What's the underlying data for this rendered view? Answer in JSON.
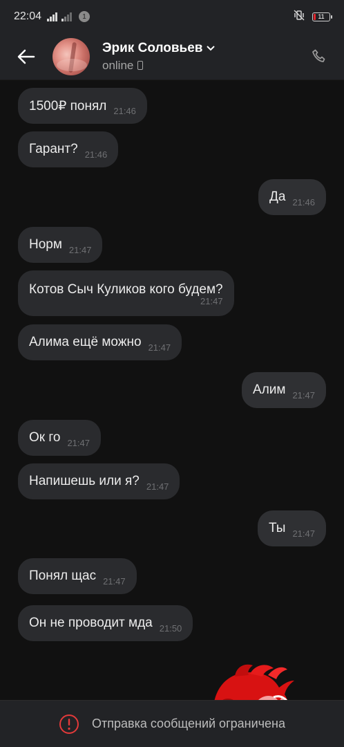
{
  "status_bar": {
    "time": "22:04",
    "notification_count": "1",
    "battery_level": "11",
    "battery_percent": 11,
    "battery_color": "#e0242b"
  },
  "header": {
    "back_icon": "arrow-left-icon",
    "contact_name": "Эрик Соловьев",
    "presence": "online",
    "device_icon": "phone-icon",
    "call_icon": "call-icon"
  },
  "messages": [
    {
      "dir": "in",
      "text": "1500₽ понял",
      "time": "21:46"
    },
    {
      "dir": "in",
      "text": "Гарант?",
      "time": "21:46"
    },
    {
      "dir": "out",
      "text": "Да",
      "time": "21:46"
    },
    {
      "dir": "in",
      "text": "Норм",
      "time": "21:47"
    },
    {
      "dir": "in",
      "text": "Котов Сыч Куликов кого будем?",
      "time": "21:47"
    },
    {
      "dir": "in",
      "text": "Алима ещё можно",
      "time": "21:47"
    },
    {
      "dir": "out",
      "text": "Алим",
      "time": "21:47"
    },
    {
      "dir": "in",
      "text": "Ок го",
      "time": "21:47"
    },
    {
      "dir": "in",
      "text": "Напишешь или я?",
      "time": "21:47"
    },
    {
      "dir": "out",
      "text": "Ты",
      "time": "21:47"
    },
    {
      "dir": "in",
      "text": "Понял щас",
      "time": "21:47"
    },
    {
      "dir": "in",
      "text": "Он не проводит мда",
      "time": "21:50"
    }
  ],
  "footer": {
    "warning_icon": "warning-icon",
    "text": "Отправка сообщений ограничена"
  },
  "colors": {
    "background": "#111111",
    "bar": "#222326",
    "bubble": "#2a2b2e",
    "warning": "#e33a3a"
  }
}
